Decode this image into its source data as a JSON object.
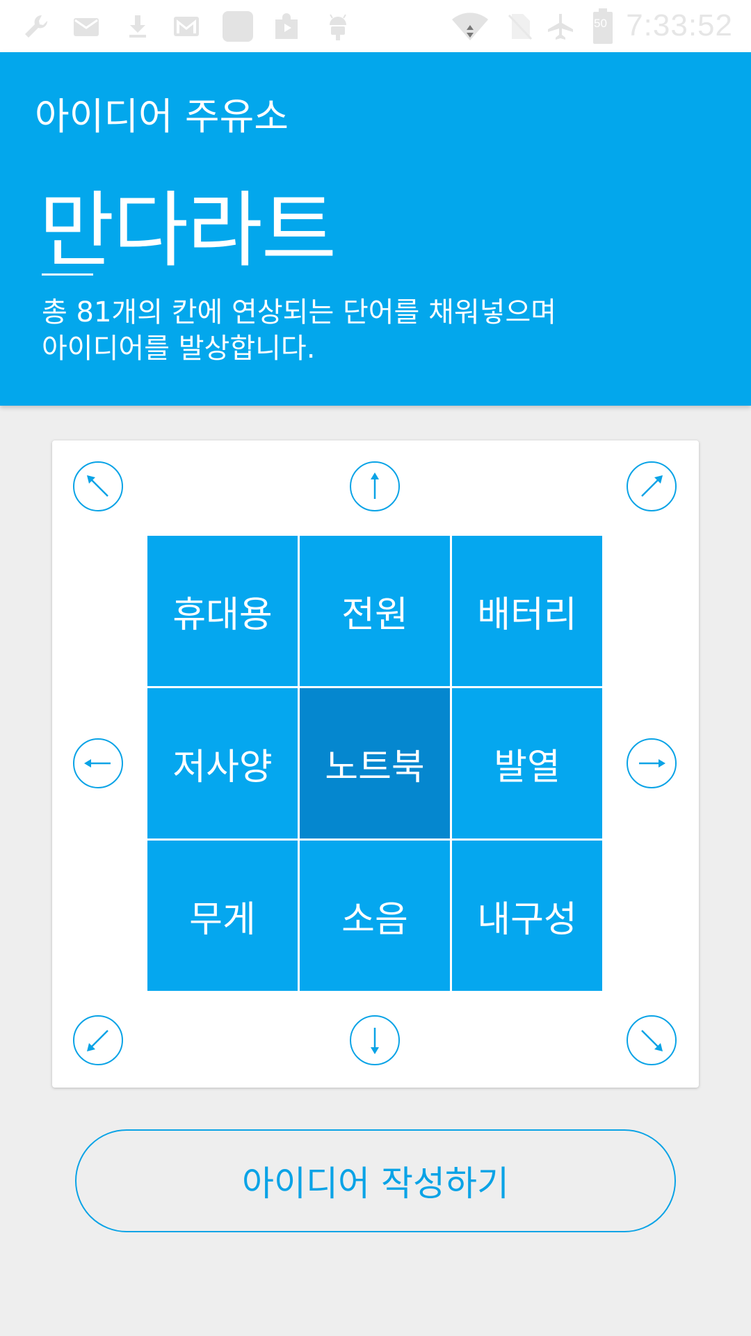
{
  "status_bar": {
    "time": "7:33:52",
    "left_icons": [
      "wrench-icon",
      "mail-icon",
      "download-icon",
      "gmail-icon",
      "app-icon",
      "store-icon",
      "android-icon"
    ],
    "right_icons": [
      "wifi-icon",
      "no-sim-icon",
      "airplane-icon",
      "battery-icon"
    ],
    "battery_level": "50"
  },
  "header": {
    "subtitle": "아이디어 주유소",
    "title": "만다라트",
    "description_lines": [
      "총 81개의 칸에 연상되는 단어를 채워넣으며",
      "아이디어를 발상합니다."
    ],
    "background_color": "#03a7ec"
  },
  "mandalart": {
    "cells": [
      "휴대용",
      "전원",
      "배터리",
      "저사양",
      "노트북",
      "발열",
      "무게",
      "소음",
      "내구성"
    ],
    "center_index": 4,
    "cell_color": "#05a7ef",
    "center_color": "#0587cf",
    "arrows": [
      "up-left",
      "up",
      "up-right",
      "left",
      "right",
      "down-left",
      "down",
      "down-right"
    ]
  },
  "write_button": {
    "label": "아이디어 작성하기",
    "color": "#0aa3e6"
  }
}
